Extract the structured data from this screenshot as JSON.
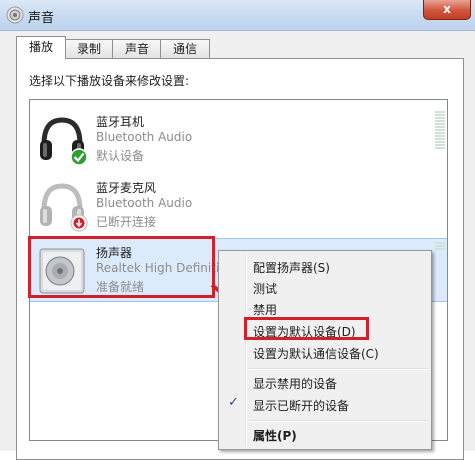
{
  "window": {
    "title": "声音",
    "close_label": "x"
  },
  "tabs": [
    {
      "label": "播放",
      "active": true
    },
    {
      "label": "录制",
      "active": false
    },
    {
      "label": "声音",
      "active": false
    },
    {
      "label": "通信",
      "active": false
    }
  ],
  "instruction": "选择以下播放设备来修改设置:",
  "devices": [
    {
      "name": "蓝牙耳机",
      "type": "Bluetooth Audio",
      "status": "默认设备",
      "icon": "headphones-icon",
      "badge": "green-check-icon"
    },
    {
      "name": "蓝牙麦克风",
      "type": "Bluetooth Audio",
      "status": "已断开连接",
      "icon": "headphones-icon",
      "badge": "red-down-arrow-icon"
    },
    {
      "name": "扬声器",
      "type": "Realtek High Definiti",
      "status": "准备就绪",
      "icon": "speaker-icon"
    }
  ],
  "context_menu": {
    "items": [
      {
        "label": "配置扬声器(S)"
      },
      {
        "label": "测试"
      },
      {
        "label": "禁用"
      },
      {
        "label": "设置为默认设备(D)"
      },
      {
        "label": "设置为默认通信设备(C)"
      },
      {
        "label": "显示禁用的设备"
      },
      {
        "label": "显示已断开的设备",
        "checked": true
      },
      {
        "label": "属性(P)",
        "bold": true
      }
    ]
  },
  "colors": {
    "highlight_red": "#d4202a",
    "selection_blue": "#dcebfc"
  }
}
